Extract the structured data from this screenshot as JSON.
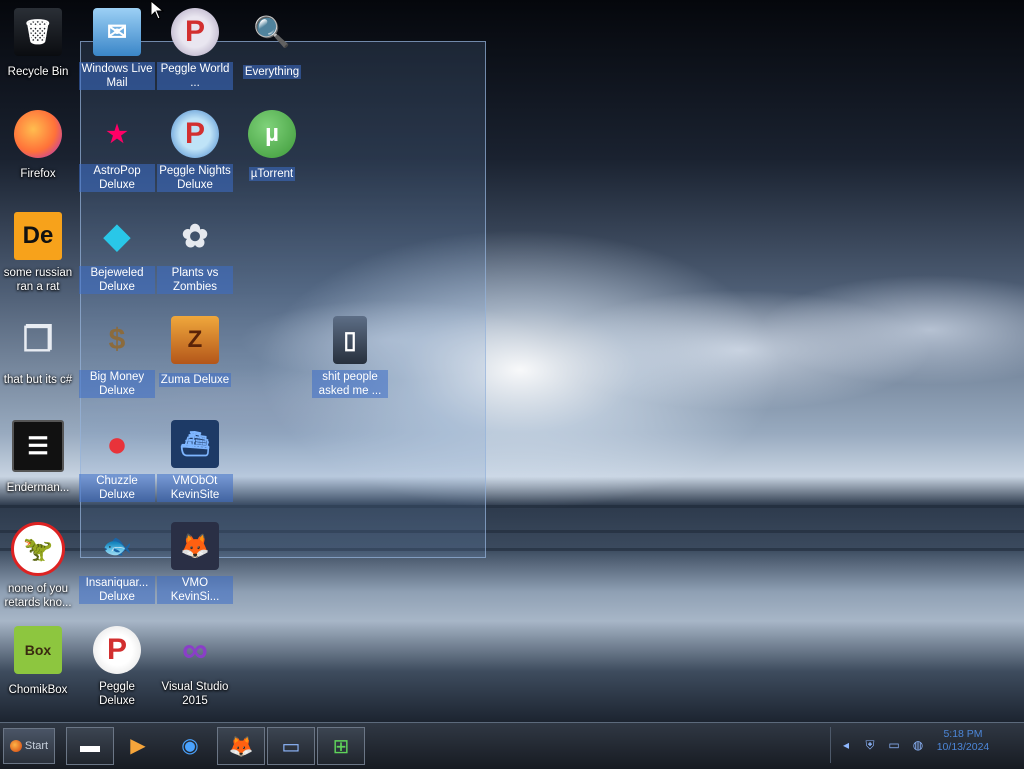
{
  "desktop": {
    "icons": [
      {
        "name": "recycle-bin",
        "label": "Recycle Bin",
        "glyph": "🗑"
      },
      {
        "name": "firefox",
        "label": "Firefox",
        "glyph": "🦊"
      },
      {
        "name": "some-russian-ran-a-rat",
        "label": "some russian ran a rat",
        "glyph": "De"
      },
      {
        "name": "that-but-its-c",
        "label": "that but its c#",
        "glyph": "❐"
      },
      {
        "name": "enderman",
        "label": "Enderman...",
        "glyph": "☰"
      },
      {
        "name": "none-of-you",
        "label": "none of you retards kno...",
        "glyph": "🦖"
      },
      {
        "name": "chomikbox",
        "label": "ChomikBox",
        "glyph": "Box"
      },
      {
        "name": "windows-live-mail",
        "label": "Windows Live Mail",
        "glyph": "✉"
      },
      {
        "name": "astropop-deluxe",
        "label": "AstroPop Deluxe",
        "glyph": "★"
      },
      {
        "name": "bejeweled-deluxe",
        "label": "Bejeweled Deluxe",
        "glyph": "◆"
      },
      {
        "name": "big-money-deluxe",
        "label": "Big Money Deluxe",
        "glyph": "$"
      },
      {
        "name": "chuzzle-deluxe",
        "label": "Chuzzle Deluxe",
        "glyph": "●"
      },
      {
        "name": "insaniquarium-deluxe",
        "label": "Insaniquar... Deluxe",
        "glyph": "🐟"
      },
      {
        "name": "peggle-deluxe",
        "label": "Peggle Deluxe",
        "glyph": "P"
      },
      {
        "name": "peggle-world",
        "label": "Peggle World ...",
        "glyph": "P"
      },
      {
        "name": "peggle-nights-deluxe",
        "label": "Peggle Nights Deluxe",
        "glyph": "P"
      },
      {
        "name": "plants-vs-zombies",
        "label": "Plants vs Zombies",
        "glyph": "✿"
      },
      {
        "name": "zuma-deluxe",
        "label": "Zuma Deluxe",
        "glyph": "Z"
      },
      {
        "name": "vmobot-kevinsite",
        "label": "VMObOt KevinSite",
        "glyph": "⛴"
      },
      {
        "name": "vmo-kevinsite",
        "label": "VMO KevinSi...",
        "glyph": "🦊"
      },
      {
        "name": "visual-studio-2015",
        "label": "Visual Studio 2015",
        "glyph": "∞"
      },
      {
        "name": "everything",
        "label": "Everything",
        "glyph": "🔍"
      },
      {
        "name": "utorrent",
        "label": "µTorrent",
        "glyph": "µ"
      },
      {
        "name": "shit-people-asked-me",
        "label": "shit people asked me ...",
        "glyph": "▯"
      }
    ]
  },
  "colors": {
    "selection": "#5c8fd6",
    "icon_label_highlight": "#3c6ec8",
    "firefox": "#ff7139",
    "vs_purple": "#8a3fc7",
    "utorrent_green": "#4eae4a",
    "peggle_red": "#d22f2f",
    "clock_blue": "#4c86d8"
  },
  "taskbar": {
    "start_label": "Start",
    "buttons": [
      {
        "name": "task-black-box",
        "glyph": "▬"
      },
      {
        "name": "task-media-player",
        "glyph": "▶"
      },
      {
        "name": "task-globe",
        "glyph": "◉"
      },
      {
        "name": "task-firefox",
        "glyph": "🦊"
      },
      {
        "name": "task-device",
        "glyph": "▭"
      },
      {
        "name": "task-windows",
        "glyph": "⊞"
      }
    ],
    "tray_icons": [
      "network-icon",
      "shield-icon",
      "monitor-icon",
      "volume-icon"
    ],
    "clock": {
      "time": "5:18 PM",
      "date": "10/13/2024"
    }
  }
}
